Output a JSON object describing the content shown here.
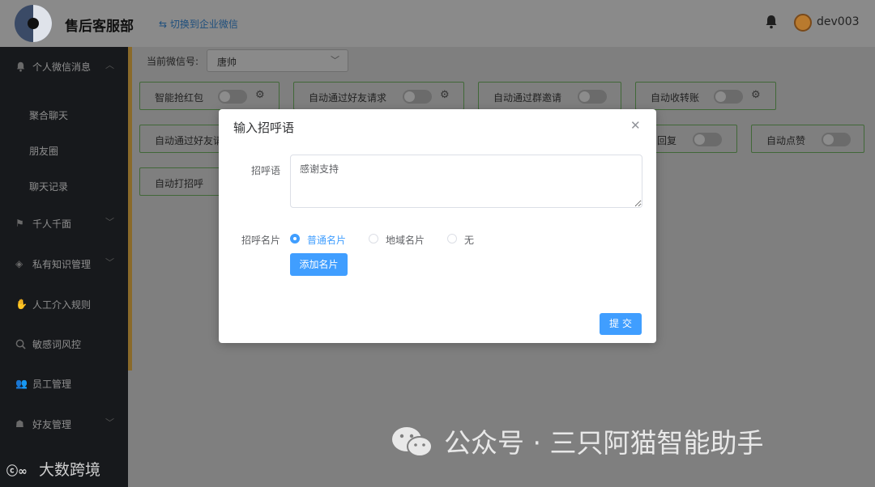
{
  "header": {
    "title": "售后客服部",
    "switch_link": "⇆ 切换到企业微信",
    "username": "dev003"
  },
  "sidebar": {
    "items": [
      {
        "label": "个人微信消息",
        "icon": "bell-icon"
      },
      {
        "label": "聚合聊天"
      },
      {
        "label": "朋友圈"
      },
      {
        "label": "聊天记录"
      },
      {
        "label": "千人千面",
        "icon": "flag-icon"
      },
      {
        "label": "私有知识管理",
        "icon": "tag-icon"
      },
      {
        "label": "人工介入规则",
        "icon": "handshake-icon"
      },
      {
        "label": "敏感词风控",
        "icon": "search-icon"
      },
      {
        "label": "员工管理",
        "icon": "users-icon"
      },
      {
        "label": "好友管理",
        "icon": "group-icon"
      }
    ],
    "bottom_logo": "大数跨境"
  },
  "main": {
    "wx_label": "当前微信号:",
    "wx_value": "唐帅",
    "cards": [
      {
        "label": "智能抢红包"
      },
      {
        "label": "自动通过好友请求"
      },
      {
        "label": "自动通过群邀请"
      },
      {
        "label": "自动收转账"
      },
      {
        "label": "自动通过好友请"
      },
      {
        "label": "回复"
      },
      {
        "label": "自动点赞"
      },
      {
        "label": "自动打招呼"
      }
    ]
  },
  "dialog": {
    "title": "输入招呼语",
    "greeting_label": "招呼语",
    "greeting_value": "感谢支持",
    "card_label": "招呼名片",
    "radio_options": [
      "普通名片",
      "地域名片",
      "无"
    ],
    "selected": "普通名片",
    "add_button": "添加名片",
    "submit_button": "提交"
  },
  "watermark": "公众号 · 三只阿猫智能助手",
  "colors": {
    "primary": "#409eff",
    "sidebar_bg": "#17191c",
    "card_border": "#416838"
  }
}
